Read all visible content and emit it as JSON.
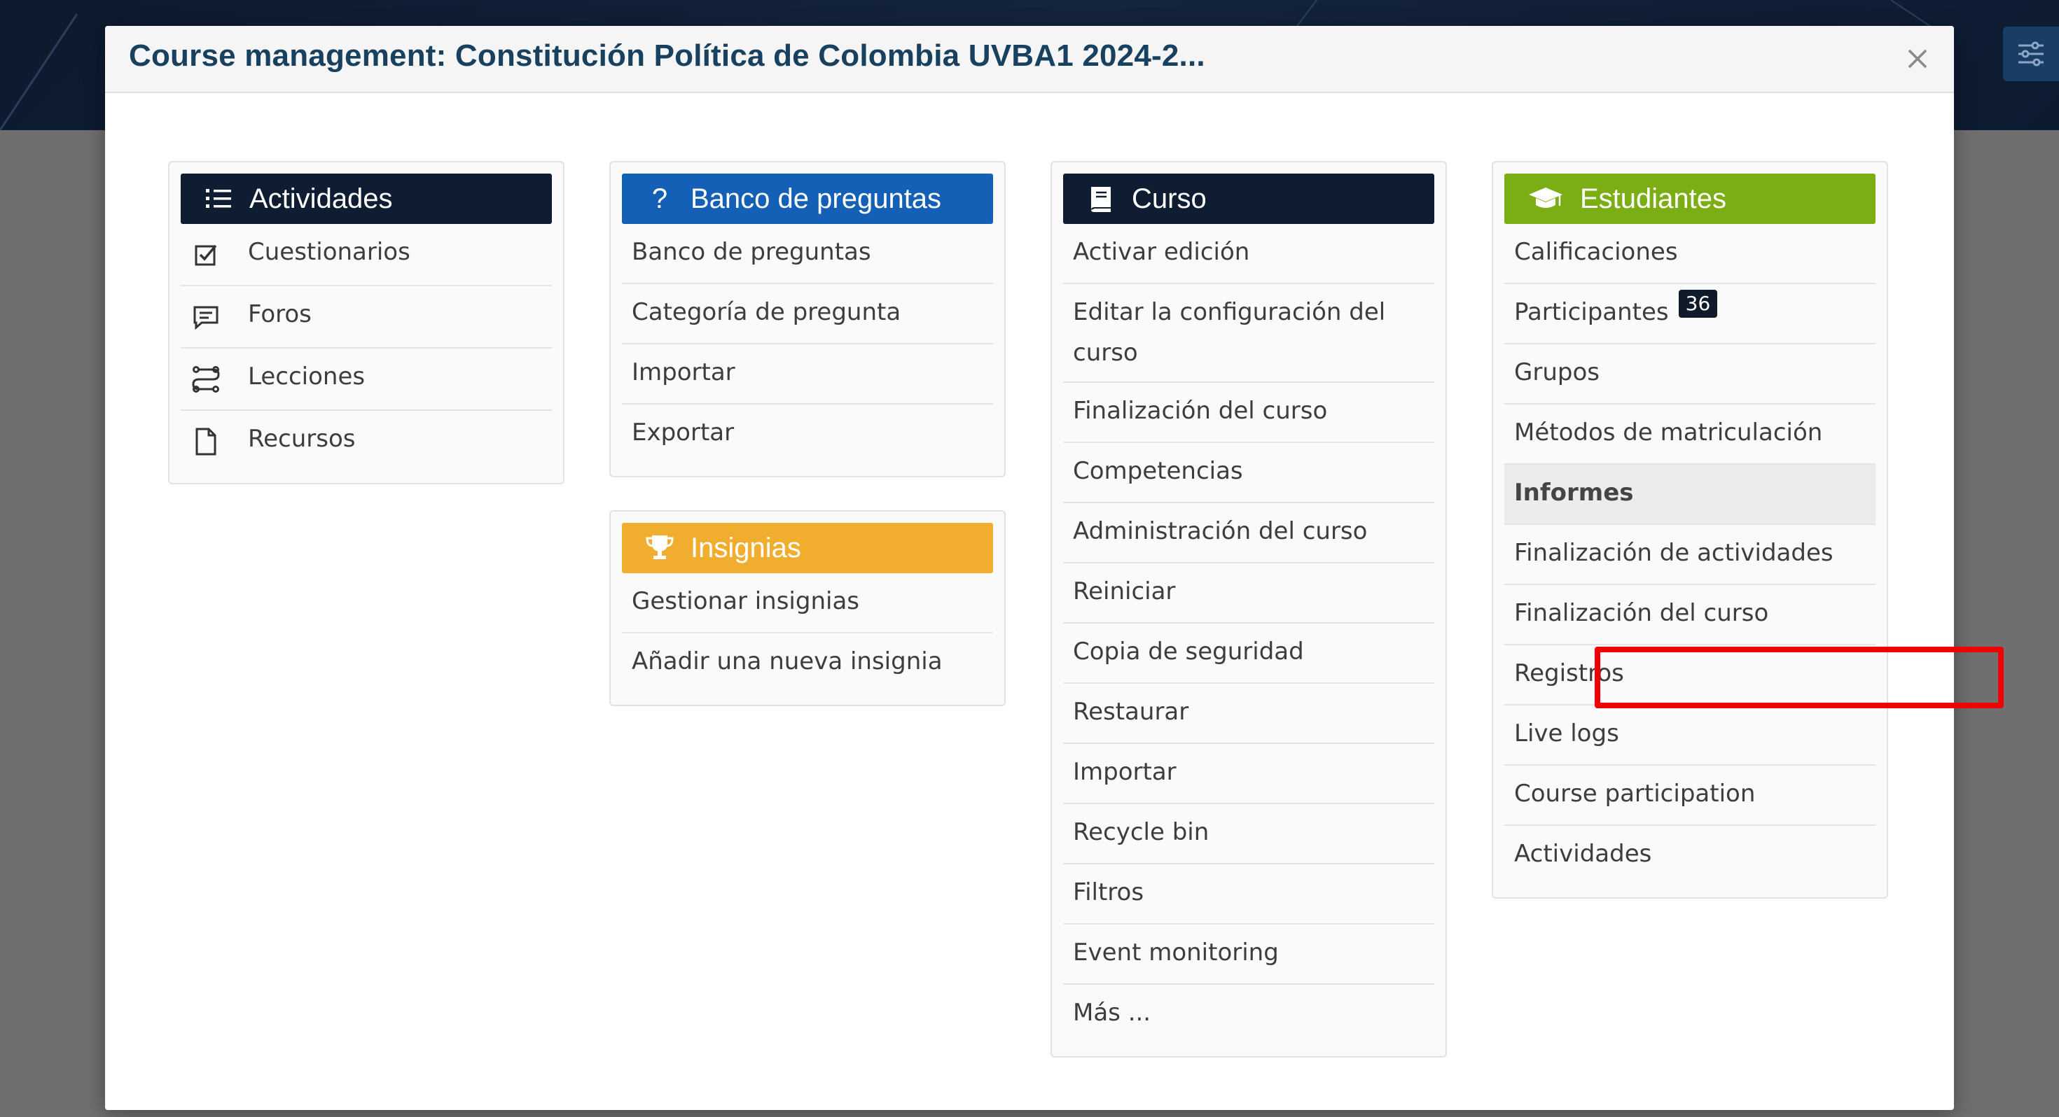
{
  "modal": {
    "title": "Course management: Constitución Política de Colombia UVBA1 2024-2..."
  },
  "colors": {
    "actividades_header": "#0f1d33",
    "banco_header": "#1560b7",
    "insignias_header": "#f0ad2e",
    "curso_header": "#0f1d33",
    "estudiantes_header": "#7bae14",
    "title_text": "#17415f",
    "highlight": "#f00000"
  },
  "actividades": {
    "header": "Actividades",
    "header_icon": "list-icon",
    "items": [
      {
        "label": "Cuestionarios",
        "icon": "checkbox-icon"
      },
      {
        "label": "Foros",
        "icon": "forum-icon"
      },
      {
        "label": "Lecciones",
        "icon": "lesson-icon"
      },
      {
        "label": "Recursos",
        "icon": "file-icon"
      }
    ]
  },
  "banco": {
    "header": "Banco de preguntas",
    "header_icon": "question-icon",
    "items": [
      "Banco de preguntas",
      "Categoría de pregunta",
      "Importar",
      "Exportar"
    ]
  },
  "insignias": {
    "header": "Insignias",
    "header_icon": "trophy-icon",
    "items": [
      "Gestionar insignias",
      "Añadir una nueva insignia"
    ]
  },
  "curso": {
    "header": "Curso",
    "header_icon": "book-icon",
    "items": [
      "Activar edición",
      "Editar la configuración del curso",
      "Finalización del curso",
      "Competencias",
      "Administración del curso",
      "Reiniciar",
      "Copia de seguridad",
      "Restaurar",
      "Importar",
      "Recycle bin",
      "Filtros",
      "Event monitoring",
      "Más ..."
    ]
  },
  "estudiantes": {
    "header": "Estudiantes",
    "header_icon": "graduation-cap-icon",
    "items": [
      "Calificaciones",
      "Participantes",
      "Grupos",
      "Métodos de matriculación"
    ],
    "participants_count": "36",
    "informes_label": "Informes",
    "informes": [
      "Finalización de actividades",
      "Finalización del curso",
      "Registros",
      "Live logs",
      "Course participation",
      "Actividades"
    ]
  }
}
